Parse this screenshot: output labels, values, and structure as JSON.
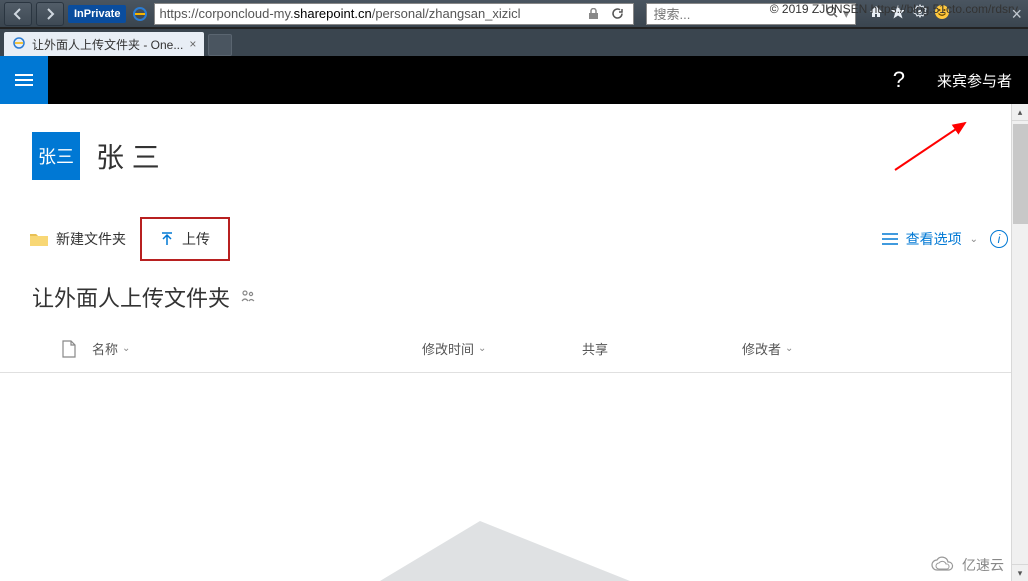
{
  "watermark": "© 2019 ZJUNSEN https://blog.51cto.com/rdsrv",
  "browser": {
    "inprivate_badge": "InPrivate",
    "url_prefix": "https://",
    "url_sub": "corponcloud-my.",
    "url_domain": "sharepoint.cn",
    "url_path": "/personal/zhangsan_xizicl",
    "search_placeholder": "搜索..."
  },
  "tab": {
    "title": "让外面人上传文件夹 - One..."
  },
  "sp_header": {
    "help": "?",
    "guest": "来宾参与者"
  },
  "user": {
    "tile": "张三",
    "name": "张 三"
  },
  "actions": {
    "new_folder": "新建文件夹",
    "upload": "上传",
    "view_options": "查看选项"
  },
  "folder": {
    "title": "让外面人上传文件夹"
  },
  "columns": {
    "name": "名称",
    "modified": "修改时间",
    "share": "共享",
    "author": "修改者"
  },
  "bottom_brand": "亿速云"
}
